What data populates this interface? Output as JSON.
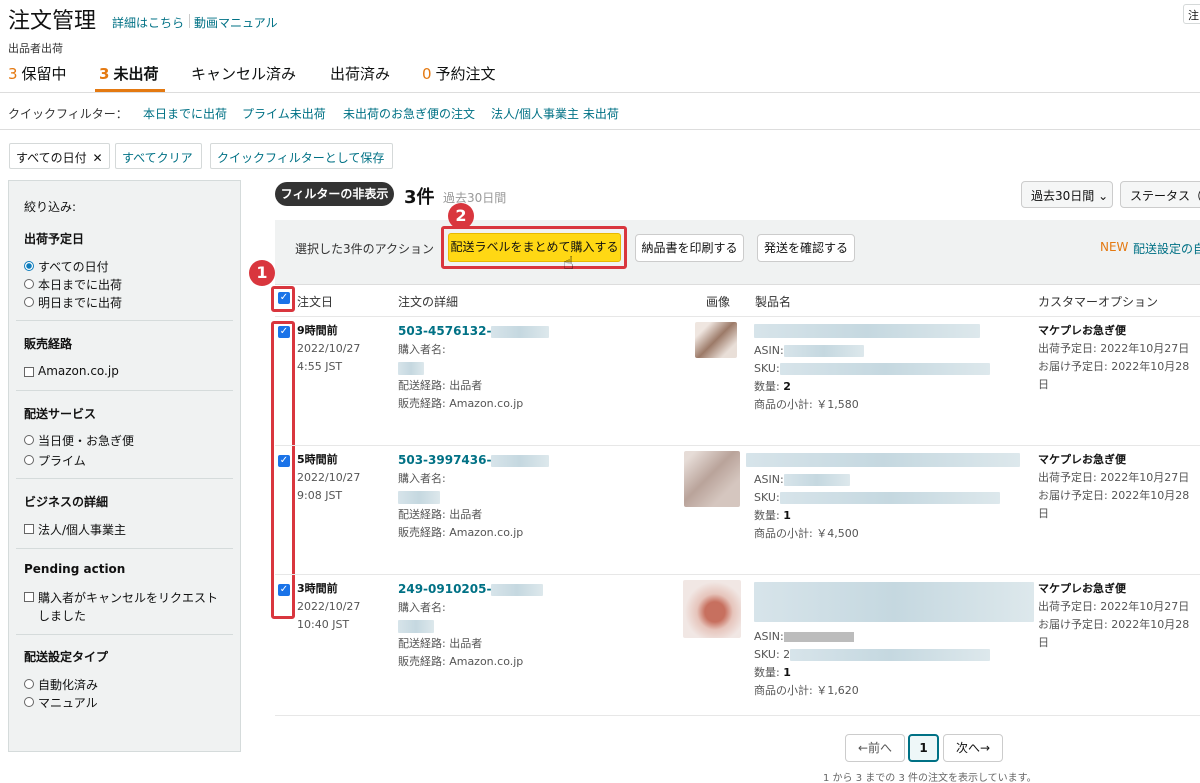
{
  "header": {
    "title": "注文管理",
    "details_link": "詳細はこちら",
    "video_link": "動画マニュアル",
    "topright_button": "注",
    "subtitle": "出品者出荷"
  },
  "tabs": [
    {
      "count": "3",
      "label": "保留中"
    },
    {
      "count": "3",
      "label": "未出荷"
    },
    {
      "count": "",
      "label": "キャンセル済み"
    },
    {
      "count": "",
      "label": "出荷済み"
    },
    {
      "count": "0",
      "label": "予約注文"
    }
  ],
  "quick_filters": {
    "label": "クイックフィルター：",
    "items": [
      "本日までに出荷",
      "プライム未出荷",
      "未出荷のお急ぎ便の注文",
      "法人/個人事業主 未出荷"
    ]
  },
  "chips": {
    "all_dates": "すべての日付",
    "close": "✕",
    "clear_all": "すべてクリア",
    "save_quick": "クイックフィルターとして保存"
  },
  "sidebar": {
    "title": "絞り込み:",
    "ship_date": {
      "heading": "出荷予定日",
      "options": [
        "すべての日付",
        "本日までに出荷",
        "明日までに出荷"
      ]
    },
    "channel": {
      "heading": "販売経路",
      "options": [
        "Amazon.co.jp"
      ]
    },
    "shipping_service": {
      "heading": "配送サービス",
      "options": [
        "当日便・お急ぎ便",
        "プライム"
      ]
    },
    "business": {
      "heading": "ビジネスの詳細",
      "options": [
        "法人/個人事業主"
      ]
    },
    "pending": {
      "heading": "Pending action",
      "options": [
        "購入者がキャンセルをリクエストしました"
      ]
    },
    "ship_type": {
      "heading": "配送設定タイプ",
      "options": [
        "自動化済み",
        "マニュアル"
      ]
    }
  },
  "results": {
    "filter_toggle": "フィルターの非表示",
    "count": "3件",
    "period": "過去30日間",
    "period_dropdown": "過去30日間",
    "status_dropdown": "ステータス（"
  },
  "action_bar": {
    "label": "選択した3件のアクション",
    "buy_labels": "配送ラベルをまとめて購入する",
    "print_slips": "納品書を印刷する",
    "confirm_ship": "発送を確認する",
    "new_badge": "NEW",
    "settings_link": "配送設定の自"
  },
  "annotations": {
    "badge1": "1",
    "badge2": "2"
  },
  "table": {
    "headers": {
      "date": "注文日",
      "details": "注文の詳細",
      "image": "画像",
      "product": "製品名",
      "customer": "カスタマーオプション"
    },
    "rows": [
      {
        "ago": "9時間前",
        "date": "2022/10/27",
        "time": "4:55 JST",
        "order_id": "503-4576132-",
        "buyer_label": "購入者名:",
        "ship_route": "配送経路: 出品者",
        "sales_channel": "販売経路: Amazon.co.jp",
        "asin": "ASIN:",
        "sku": "SKU:",
        "qty_label": "数量: ",
        "qty": "2",
        "subtotal_label": "商品の小計: ",
        "subtotal": "￥1,580",
        "option": "マケプレお急ぎ便",
        "ship_by": "出荷予定日: 2022年10月27日",
        "deliver_by": "お届け予定日: 2022年10月28日"
      },
      {
        "ago": "5時間前",
        "date": "2022/10/27",
        "time": "9:08 JST",
        "order_id": "503-3997436-",
        "buyer_label": "購入者名:",
        "ship_route": "配送経路: 出品者",
        "sales_channel": "販売経路: Amazon.co.jp",
        "asin": "ASIN:",
        "sku": "SKU:",
        "qty_label": "数量: ",
        "qty": "1",
        "subtotal_label": "商品の小計: ",
        "subtotal": "￥4,500",
        "option": "マケプレお急ぎ便",
        "ship_by": "出荷予定日: 2022年10月27日",
        "deliver_by": "お届け予定日: 2022年10月28日"
      },
      {
        "ago": "3時間前",
        "date": "2022/10/27",
        "time": "10:40 JST",
        "order_id": "249-0910205-",
        "buyer_label": "購入者名:",
        "ship_route": "配送経路: 出品者",
        "sales_channel": "販売経路: Amazon.co.jp",
        "asin": "ASIN:",
        "sku": "SKU: 2",
        "qty_label": "数量: ",
        "qty": "1",
        "subtotal_label": "商品の小計: ",
        "subtotal": "￥1,620",
        "option": "マケプレお急ぎ便",
        "ship_by": "出荷予定日: 2022年10月27日",
        "deliver_by": "お届け予定日: 2022年10月28日"
      }
    ]
  },
  "pagination": {
    "prev": "←前へ",
    "current": "1",
    "next": "次へ→",
    "info": "1 から 3 までの 3 件の注文を表示しています。"
  },
  "colors": {
    "accent": "#e47911",
    "link": "#007185",
    "highlight": "#d9363e",
    "primary_button": "#ffd814"
  }
}
